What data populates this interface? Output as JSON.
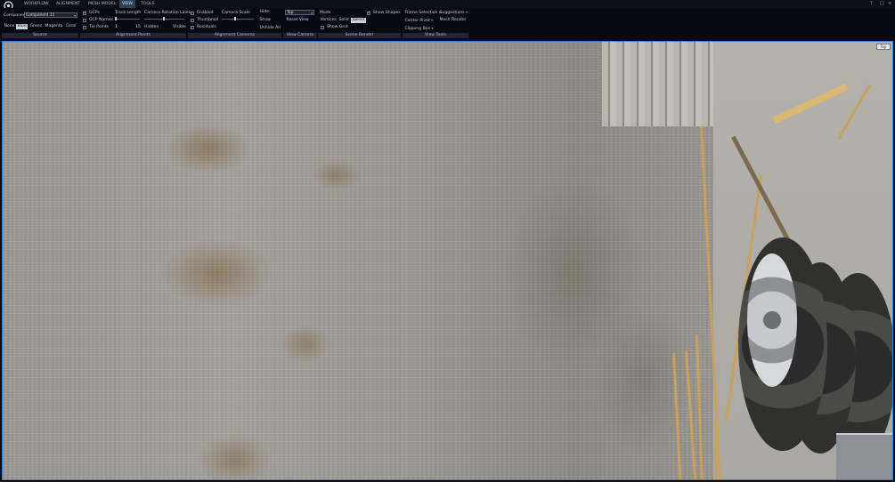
{
  "tabs": [
    {
      "label": "WORKFLOW"
    },
    {
      "label": "ALIGNMENT"
    },
    {
      "label": "MESH MODEL"
    },
    {
      "label": "VIEW"
    },
    {
      "label": "TOOLS"
    }
  ],
  "window_controls": {
    "help": "?",
    "maximize": "□",
    "close": "×"
  },
  "source": {
    "component_label": "Component",
    "component_value": "Component 11",
    "colors": [
      {
        "label": "None",
        "selected": false
      },
      {
        "label": "Blue",
        "selected": true
      },
      {
        "label": "Green",
        "selected": false
      },
      {
        "label": "Magenta",
        "selected": false
      },
      {
        "label": "Coral",
        "selected": false
      }
    ],
    "footer": "Source"
  },
  "alignment_points": {
    "gcps": {
      "label": "GCPs",
      "checked": true
    },
    "gcp_names": {
      "label": "GCP Names",
      "checked": false
    },
    "tie_points": {
      "label": "Tie Points",
      "checked": false
    },
    "track_length": {
      "label": "Track Length",
      "min": "1",
      "max": "15",
      "value_fraction": 0.02
    },
    "camera_rotation_lines": {
      "label": "Camera Rotation Lines",
      "left": "Hidden",
      "right": "Visible",
      "value_fraction": 0.5
    },
    "footer": "Alignment Points"
  },
  "alignment_cameras": {
    "enabled": {
      "label": "Enabled",
      "checked": false
    },
    "thumbnail": {
      "label": "Thumbnail",
      "checked": false
    },
    "residuals": {
      "label": "Residuals",
      "checked": false
    },
    "camera_scale": {
      "label": "Camera Scale",
      "value_fraction": 0.4
    },
    "actions": [
      "Hide",
      "Show",
      "Unhide All"
    ],
    "footer": "Alignment Cameras"
  },
  "view_camera": {
    "view_value": "Top",
    "reset_label": "Reset View",
    "footer": "View Camera"
  },
  "scene_render": {
    "mode_label": "Mode",
    "modes": [
      {
        "label": "Vertices",
        "selected": false
      },
      {
        "label": "Solid",
        "selected": false
      },
      {
        "label": "Sweet",
        "selected": true
      }
    ],
    "show_grid": {
      "label": "Show Grid",
      "checked": false
    },
    "show_shapes": {
      "label": "Show Shapes",
      "checked": true
    },
    "footer": "Scene Render"
  },
  "view_tools": {
    "frame_selection": "Frame Selection",
    "suggestions": "Suggestions",
    "center_pivot": "Center Pivot",
    "mesh_render": "Mesh Render",
    "clipping_box": "Clipping Box",
    "footer": "View Tools"
  },
  "viewport": {
    "view_indicator": "Top"
  },
  "colors": {
    "accent": "#3d7fd1",
    "active_tab": "#2f4157",
    "ribbon_bg": "#070a10",
    "footer_bg": "#1e2632"
  }
}
